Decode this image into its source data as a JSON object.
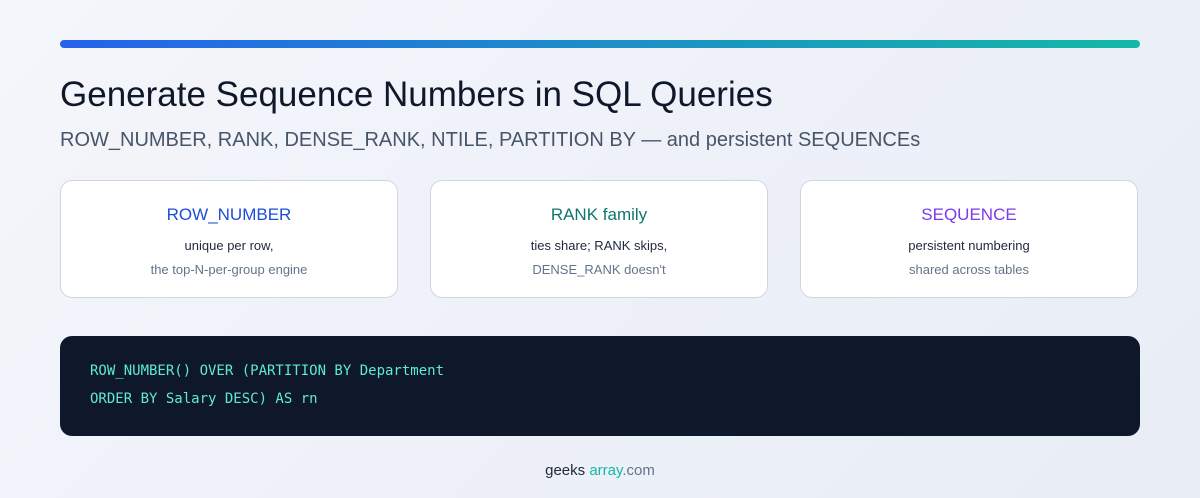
{
  "header": {
    "title": "Generate Sequence Numbers in SQL Queries",
    "subtitle": "ROW_NUMBER, RANK, DENSE_RANK, NTILE, PARTITION BY — and persistent SEQUENCEs"
  },
  "colors": {
    "accent_start": "#2563eb",
    "accent_end": "#14b8a6",
    "card1_title": "#1d4ed8",
    "card2_title": "#0f766e",
    "card3_title": "#7c3aed",
    "code_bg": "#0f172a",
    "code_text": "#5eead4"
  },
  "cards": [
    {
      "title": "ROW_NUMBER",
      "line1": "unique per row,",
      "line2": "the top-N-per-group engine"
    },
    {
      "title": "RANK family",
      "line1": "ties share; RANK skips,",
      "line2": "DENSE_RANK doesn't"
    },
    {
      "title": "SEQUENCE",
      "line1": "persistent numbering",
      "line2": "shared across tables"
    }
  ],
  "code": {
    "lines": [
      "ROW_NUMBER() OVER (PARTITION BY Department",
      "ORDER BY Salary DESC) AS rn"
    ]
  },
  "footer": {
    "part1": "geeks",
    "part2": "array",
    "part3": ".com"
  }
}
